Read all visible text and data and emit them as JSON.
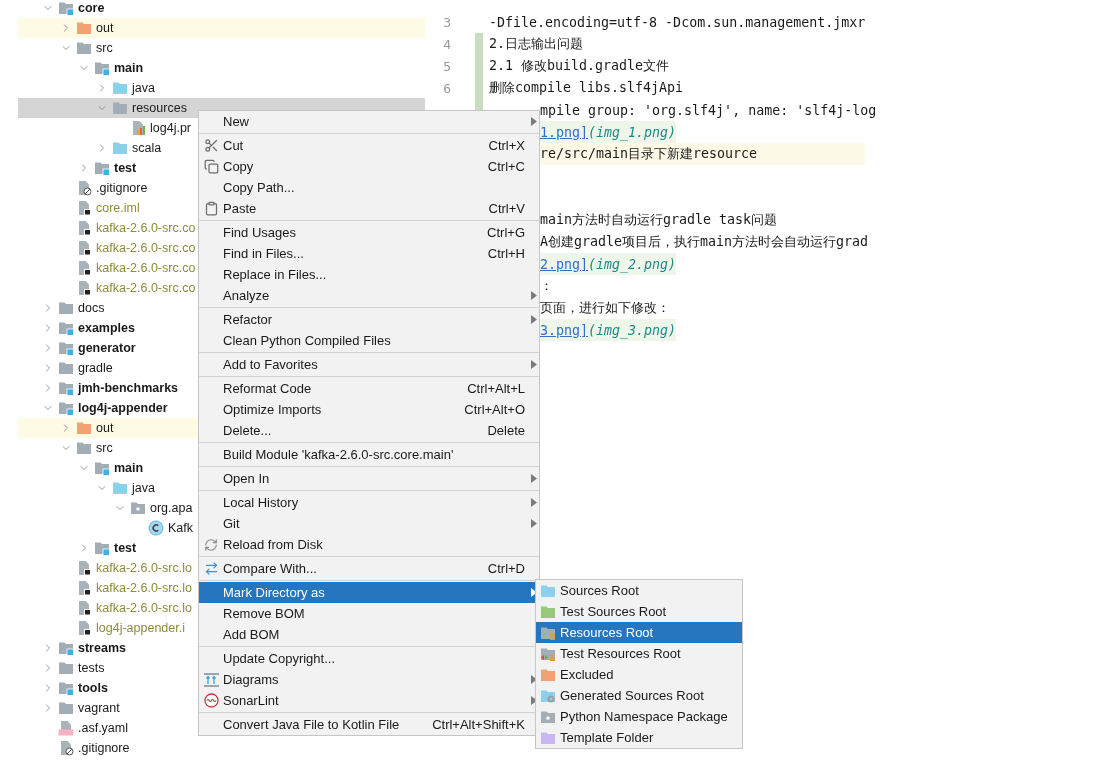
{
  "tree": [
    {
      "label": "core",
      "kind": "module",
      "bold": true,
      "expanded": true,
      "selected": false,
      "children": [
        {
          "label": "out",
          "kind": "excluded",
          "bold": false,
          "expanded": false,
          "selected": false
        },
        {
          "label": "src",
          "kind": "folder",
          "bold": false,
          "expanded": true,
          "selected": false,
          "children": [
            {
              "label": "main",
              "kind": "module",
              "bold": true,
              "expanded": true,
              "selected": false,
              "children": [
                {
                  "label": "java",
                  "kind": "source",
                  "bold": false,
                  "expanded": false,
                  "selected": false
                },
                {
                  "label": "resources",
                  "kind": "folder",
                  "bold": false,
                  "expanded": true,
                  "selected": true,
                  "children": [
                    {
                      "label": "log4j.pr",
                      "kind": "properties",
                      "bold": false,
                      "ignored": false,
                      "selected": false
                    }
                  ]
                },
                {
                  "label": "scala",
                  "kind": "source",
                  "bold": false,
                  "expanded": false,
                  "selected": false
                }
              ]
            },
            {
              "label": "test",
              "kind": "module",
              "bold": true,
              "expanded": false,
              "selected": false
            }
          ]
        },
        {
          "label": ".gitignore",
          "kind": "gitignore",
          "bold": false,
          "ignored": false,
          "selected": false
        },
        {
          "label": "core.iml",
          "kind": "iml",
          "bold": false,
          "ignored": true,
          "selected": false
        },
        {
          "label": "kafka-2.6.0-src.co",
          "kind": "iml",
          "bold": false,
          "ignored": true,
          "selected": false
        },
        {
          "label": "kafka-2.6.0-src.co",
          "kind": "iml",
          "bold": false,
          "ignored": true,
          "selected": false
        },
        {
          "label": "kafka-2.6.0-src.co",
          "kind": "iml",
          "bold": false,
          "ignored": true,
          "selected": false
        },
        {
          "label": "kafka-2.6.0-src.co",
          "kind": "iml",
          "bold": false,
          "ignored": true,
          "selected": false
        }
      ]
    },
    {
      "label": "docs",
      "kind": "folder",
      "bold": false,
      "expanded": false,
      "selected": false
    },
    {
      "label": "examples",
      "kind": "module",
      "bold": true,
      "expanded": false,
      "selected": false
    },
    {
      "label": "generator",
      "kind": "module",
      "bold": true,
      "expanded": false,
      "selected": false
    },
    {
      "label": "gradle",
      "kind": "folder",
      "bold": false,
      "expanded": false,
      "selected": false
    },
    {
      "label": "jmh-benchmarks",
      "kind": "module",
      "bold": true,
      "expanded": false,
      "selected": false
    },
    {
      "label": "log4j-appender",
      "kind": "module",
      "bold": true,
      "expanded": true,
      "selected": false,
      "children": [
        {
          "label": "out",
          "kind": "excluded",
          "bold": false,
          "expanded": false,
          "selected": false
        },
        {
          "label": "src",
          "kind": "folder",
          "bold": false,
          "expanded": true,
          "selected": false,
          "children": [
            {
              "label": "main",
              "kind": "module",
              "bold": true,
              "expanded": true,
              "selected": false,
              "children": [
                {
                  "label": "java",
                  "kind": "source",
                  "bold": false,
                  "expanded": true,
                  "selected": false,
                  "children": [
                    {
                      "label": "org.apa",
                      "kind": "package",
                      "bold": false,
                      "expanded": true,
                      "selected": false,
                      "children": [
                        {
                          "label": "Kafk",
                          "kind": "class",
                          "bold": false,
                          "ignored": false,
                          "selected": false
                        }
                      ]
                    }
                  ]
                }
              ]
            },
            {
              "label": "test",
              "kind": "module",
              "bold": true,
              "expanded": false,
              "selected": false
            }
          ]
        },
        {
          "label": "kafka-2.6.0-src.lo",
          "kind": "iml",
          "bold": false,
          "ignored": true,
          "selected": false
        },
        {
          "label": "kafka-2.6.0-src.lo",
          "kind": "iml",
          "bold": false,
          "ignored": true,
          "selected": false
        },
        {
          "label": "kafka-2.6.0-src.lo",
          "kind": "iml",
          "bold": false,
          "ignored": true,
          "selected": false
        },
        {
          "label": "log4j-appender.i",
          "kind": "iml",
          "bold": false,
          "ignored": true,
          "selected": false
        }
      ]
    },
    {
      "label": "streams",
      "kind": "module",
      "bold": true,
      "expanded": false,
      "selected": false
    },
    {
      "label": "tests",
      "kind": "folder",
      "bold": false,
      "expanded": false,
      "selected": false
    },
    {
      "label": "tools",
      "kind": "module",
      "bold": true,
      "expanded": false,
      "selected": false
    },
    {
      "label": "vagrant",
      "kind": "folder",
      "bold": false,
      "expanded": false,
      "selected": false
    },
    {
      "label": ".asf.yaml",
      "kind": "yaml",
      "bold": false,
      "ignored": false,
      "selected": false
    },
    {
      "label": ".gitignore",
      "kind": "gitignore",
      "bold": false,
      "ignored": false,
      "selected": false
    }
  ],
  "editor": {
    "lines": [
      {
        "number": "3",
        "kind": "text",
        "text": "-Dfile.encoding=utf-8 -Dcom.sun.management.jmxr",
        "changed": false,
        "covered": false,
        "current": false
      },
      {
        "number": "4",
        "kind": "text",
        "text": "2.日志输出问题",
        "changed": true,
        "covered": false,
        "current": false
      },
      {
        "number": "5",
        "kind": "text",
        "text": "2.1 修改build.gradle文件",
        "changed": true,
        "covered": false,
        "current": false
      },
      {
        "number": "6",
        "kind": "text",
        "text": "删除compile libs.slf4jApi",
        "changed": true,
        "covered": false,
        "current": false
      },
      {
        "kind": "text",
        "text": "mpile group: 'org.slf4j', name: 'slf4j-log",
        "changed": true,
        "covered": true,
        "current": false
      },
      {
        "kind": "image-link",
        "link": "1.png]",
        "target": "(img_1.png)",
        "changed": false,
        "covered": true,
        "current": false
      },
      {
        "kind": "text",
        "text": "re/src/main目录下新建resource",
        "changed": false,
        "covered": true,
        "current": true
      },
      {
        "kind": "blank",
        "current": false
      },
      {
        "kind": "blank",
        "current": false
      },
      {
        "kind": "text",
        "text": "main方法时自动运行gradle task问题",
        "changed": false,
        "covered": true,
        "current": false
      },
      {
        "kind": "text",
        "text": "A创建gradle项目后，执行main方法时会自动运行grad",
        "changed": false,
        "covered": true,
        "current": false
      },
      {
        "kind": "image-link",
        "link": "2.png]",
        "target": "(img_2.png)",
        "changed": false,
        "covered": true,
        "current": false
      },
      {
        "kind": "text",
        "text": "：",
        "changed": false,
        "covered": true,
        "current": false
      },
      {
        "kind": "text",
        "text": "页面，进行如下修改：",
        "changed": false,
        "covered": true,
        "current": false
      },
      {
        "kind": "image-link",
        "link": "3.png]",
        "target": "(img_3.png)",
        "changed": false,
        "covered": true,
        "current": false
      }
    ]
  },
  "context_menu": {
    "groups": [
      [
        {
          "label": "New",
          "kind": "plain",
          "submenu": true,
          "selected": false
        }
      ],
      [
        {
          "label": "Cut",
          "kind": "cut",
          "shortcut": "Ctrl+X",
          "submenu": false,
          "selected": false
        },
        {
          "label": "Copy",
          "kind": "copy",
          "shortcut": "Ctrl+C",
          "submenu": false,
          "selected": false
        },
        {
          "label": "Copy Path...",
          "kind": "plain",
          "submenu": false,
          "selected": false
        },
        {
          "label": "Paste",
          "kind": "paste",
          "shortcut": "Ctrl+V",
          "submenu": false,
          "selected": false
        }
      ],
      [
        {
          "label": "Find Usages",
          "kind": "plain",
          "shortcut": "Ctrl+G",
          "submenu": false,
          "selected": false
        },
        {
          "label": "Find in Files...",
          "kind": "plain",
          "shortcut": "Ctrl+H",
          "submenu": false,
          "selected": false
        },
        {
          "label": "Replace in Files...",
          "kind": "plain",
          "submenu": false,
          "selected": false
        },
        {
          "label": "Analyze",
          "kind": "plain",
          "submenu": true,
          "selected": false
        }
      ],
      [
        {
          "label": "Refactor",
          "kind": "plain",
          "submenu": true,
          "selected": false
        },
        {
          "label": "Clean Python Compiled Files",
          "kind": "plain",
          "submenu": false,
          "selected": false
        }
      ],
      [
        {
          "label": "Add to Favorites",
          "kind": "plain",
          "submenu": true,
          "selected": false
        }
      ],
      [
        {
          "label": "Reformat Code",
          "kind": "plain",
          "shortcut": "Ctrl+Alt+L",
          "submenu": false,
          "selected": false
        },
        {
          "label": "Optimize Imports",
          "kind": "plain",
          "shortcut": "Ctrl+Alt+O",
          "submenu": false,
          "selected": false
        },
        {
          "label": "Delete...",
          "kind": "plain",
          "shortcut": "Delete",
          "submenu": false,
          "selected": false
        }
      ],
      [
        {
          "label": "Build Module 'kafka-2.6.0-src.core.main'",
          "kind": "plain",
          "submenu": false,
          "selected": false
        }
      ],
      [
        {
          "label": "Open In",
          "kind": "plain",
          "submenu": true,
          "selected": false
        }
      ],
      [
        {
          "label": "Local History",
          "kind": "plain",
          "submenu": true,
          "selected": false
        },
        {
          "label": "Git",
          "kind": "plain",
          "submenu": true,
          "selected": false
        },
        {
          "label": "Reload from Disk",
          "kind": "reload",
          "submenu": false,
          "selected": false
        }
      ],
      [
        {
          "label": "Compare With...",
          "kind": "compare",
          "shortcut": "Ctrl+D",
          "submenu": false,
          "selected": false
        }
      ],
      [
        {
          "label": "Mark Directory as",
          "kind": "plain",
          "submenu": true,
          "selected": true
        },
        {
          "label": "Remove BOM",
          "kind": "plain",
          "submenu": false,
          "selected": false
        },
        {
          "label": "Add BOM",
          "kind": "plain",
          "submenu": false,
          "selected": false
        }
      ],
      [
        {
          "label": "Update Copyright...",
          "kind": "plain",
          "submenu": false,
          "selected": false
        },
        {
          "label": "Diagrams",
          "kind": "diagrams",
          "submenu": true,
          "selected": false
        },
        {
          "label": "SonarLint",
          "kind": "sonarlint",
          "submenu": true,
          "selected": false
        }
      ],
      [
        {
          "label": "Convert Java File to Kotlin File",
          "kind": "plain",
          "shortcut": "Ctrl+Alt+Shift+K",
          "submenu": false,
          "selected": false
        }
      ]
    ]
  },
  "submenu": {
    "items": [
      {
        "label": "Sources Root",
        "kind": "source",
        "selected": false
      },
      {
        "label": "Test Sources Root",
        "kind": "test",
        "selected": false
      },
      {
        "label": "Resources Root",
        "kind": "resource",
        "selected": true
      },
      {
        "label": "Test Resources Root",
        "kind": "test-resource",
        "selected": false
      },
      {
        "label": "Excluded",
        "kind": "excluded",
        "selected": false
      },
      {
        "label": "Generated Sources Root",
        "kind": "generated",
        "selected": false
      },
      {
        "label": "Python Namespace Package",
        "kind": "namespace",
        "selected": false
      },
      {
        "label": "Template Folder",
        "kind": "template",
        "selected": false
      }
    ]
  }
}
